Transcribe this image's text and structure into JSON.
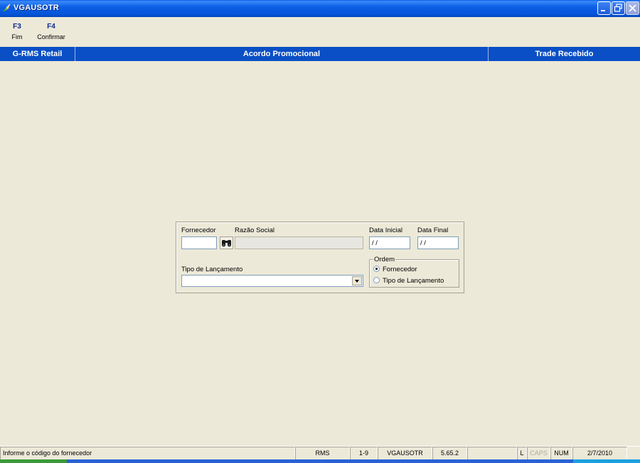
{
  "window": {
    "title": "VGAUSOTR"
  },
  "toolbar": {
    "keys": [
      {
        "key": "F3",
        "label": "Fim"
      },
      {
        "key": "F4",
        "label": "Confirmar"
      }
    ]
  },
  "header": {
    "left": "G-RMS Retail",
    "center": "Acordo Promocional",
    "right": "Trade Recebido"
  },
  "form": {
    "fornecedor_label": "Fornecedor",
    "fornecedor_value": "",
    "razao_social_label": "Razão Social",
    "razao_social_value": "",
    "data_inicial_label": "Data Inicial",
    "data_inicial_value": "/ /",
    "data_final_label": "Data Final",
    "data_final_value": "/ /",
    "tipo_lancamento_label": "Tipo de Lançamento",
    "tipo_lancamento_value": "",
    "ordem": {
      "legend": "Ordem",
      "options": [
        {
          "label": "Fornecedor",
          "selected": true
        },
        {
          "label": "Tipo de Lançamento",
          "selected": false
        }
      ]
    }
  },
  "statusbar": {
    "message": "Informe o código do fornecedor",
    "system": "RMS",
    "range": "1-9",
    "program": "VGAUSOTR",
    "version": "5.65.2",
    "blank": "",
    "l_flag": "L",
    "caps": "CAPS",
    "num": "NUM",
    "date": "2/7/2010"
  },
  "colors": {
    "titlebar": "#0654d8",
    "header_bar": "#0a4fc5",
    "background": "#ece9d8",
    "fkey_text": "#0d2a8c"
  },
  "icons": {
    "app": "app-leaf-icon",
    "search": "binoculars-icon",
    "dropdown": "chevron-down-icon"
  }
}
